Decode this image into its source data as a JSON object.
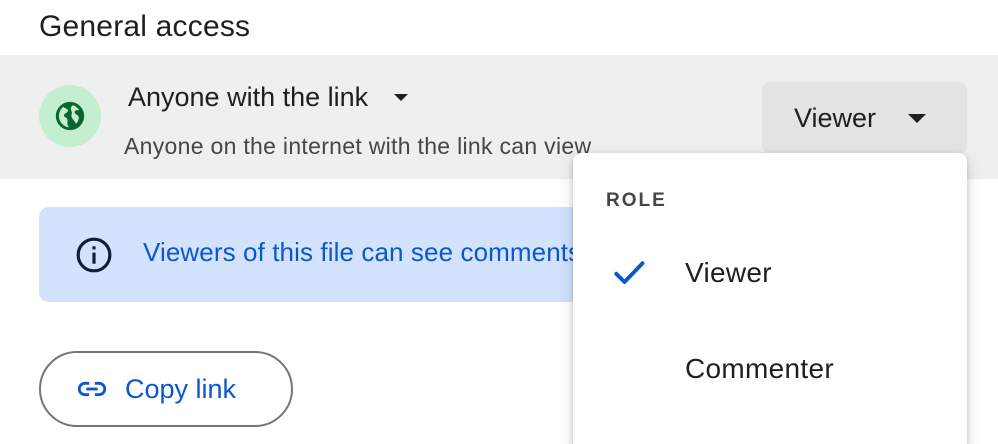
{
  "section": {
    "title": "General access"
  },
  "access": {
    "type_label": "Anyone with the link",
    "description": "Anyone on the internet with the link can view",
    "role_button_label": "Viewer",
    "icon": "globe-icon"
  },
  "info_banner": {
    "text": "Viewers of this file can see comments and suggestions",
    "icon": "info-icon"
  },
  "copy_link": {
    "label": "Copy link",
    "icon": "link-icon"
  },
  "role_menu": {
    "header": "ROLE",
    "items": [
      {
        "label": "Viewer",
        "selected": true
      },
      {
        "label": "Commenter",
        "selected": false
      }
    ]
  },
  "colors": {
    "accent": "#0b57d0",
    "globe_bg": "#c4eed0",
    "globe_fg": "#0d652d",
    "banner_bg": "#d3e3fd",
    "row_bg": "#efefef"
  }
}
